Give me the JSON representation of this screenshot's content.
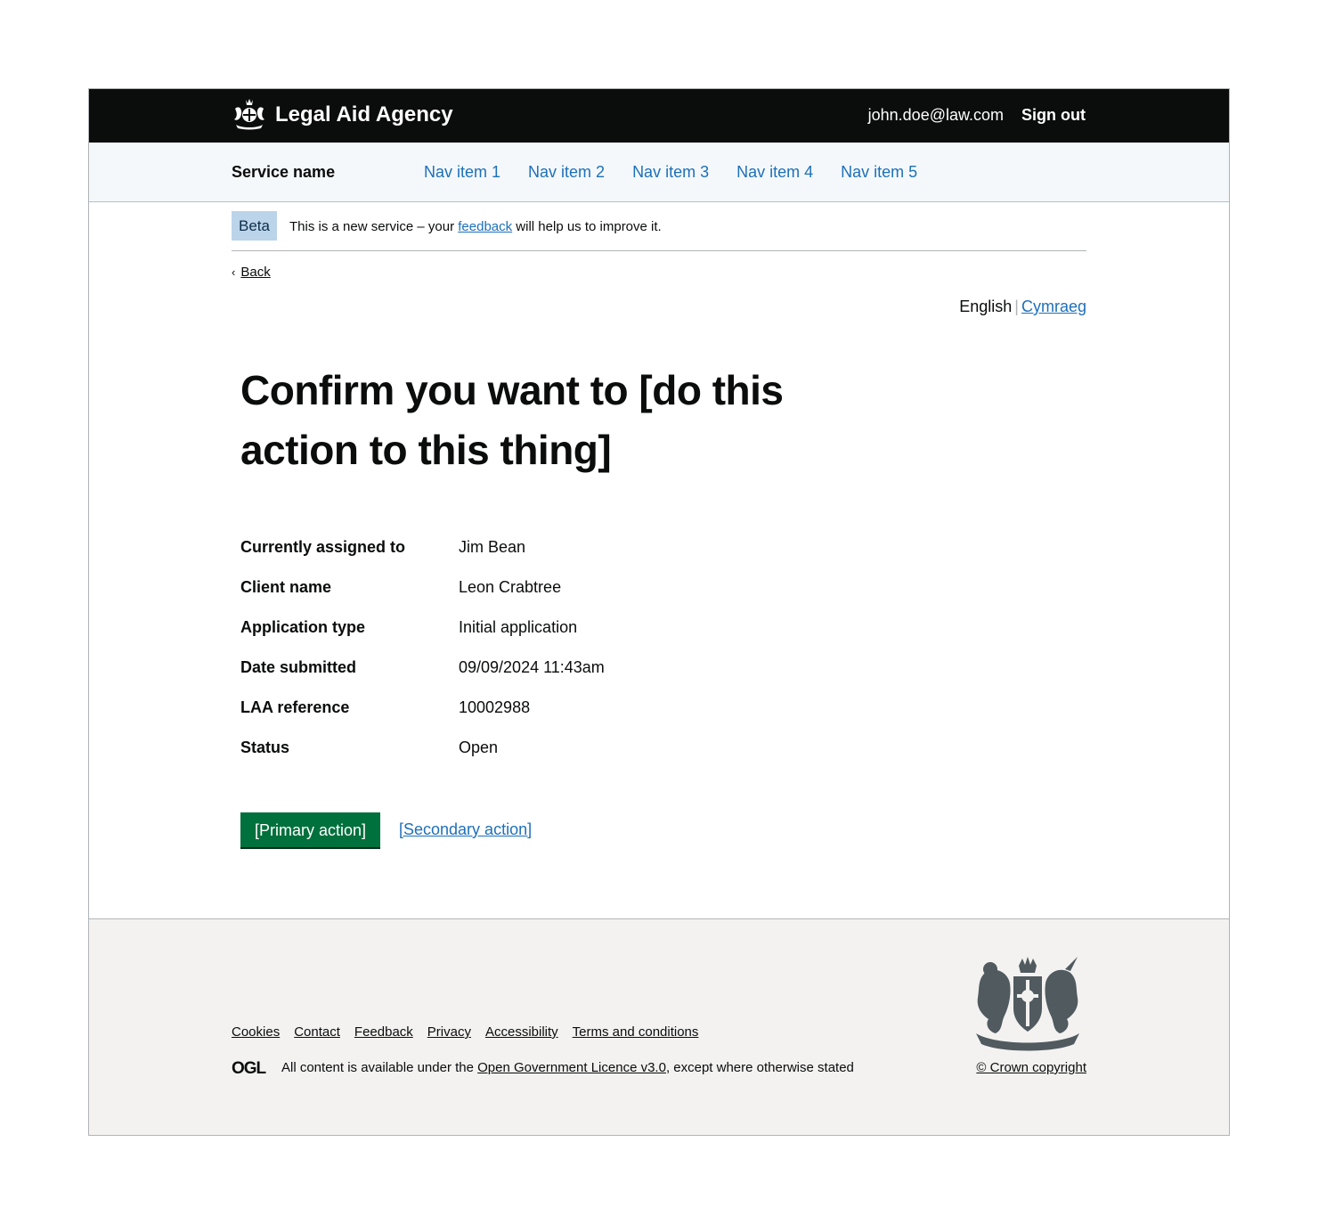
{
  "header": {
    "agency_name": "Legal Aid Agency",
    "user_email": "john.doe@law.com",
    "sign_out_label": "Sign out",
    "background_color": "#0b0c0c"
  },
  "service_nav": {
    "service_name": "Service name",
    "items": [
      {
        "label": "Nav item 1"
      },
      {
        "label": "Nav item 2"
      },
      {
        "label": "Nav item 3"
      },
      {
        "label": "Nav item 4"
      },
      {
        "label": "Nav item 5"
      }
    ]
  },
  "phase_banner": {
    "tag": "Beta",
    "text_before": "This is a new service – your ",
    "link_text": "feedback",
    "text_after": " will help us to improve it."
  },
  "back_link": {
    "chevron": "‹",
    "label": "Back"
  },
  "language": {
    "current": "English",
    "separator": "|",
    "alternate": "Cymraeg"
  },
  "main": {
    "title": "Confirm you want to [do this action to this thing]",
    "summary": [
      {
        "key": "Currently assigned to",
        "value": "Jim Bean"
      },
      {
        "key": "Client name",
        "value": "Leon Crabtree"
      },
      {
        "key": "Application type",
        "value": "Initial application"
      },
      {
        "key": "Date submitted",
        "value": "09/09/2024 11:43am"
      },
      {
        "key": "LAA reference",
        "value": "10002988"
      },
      {
        "key": "Status",
        "value": "Open"
      }
    ],
    "primary_action": "[Primary action]",
    "secondary_action": "[Secondary action]",
    "primary_color": "#00703c",
    "link_color": "#1d70b8"
  },
  "footer": {
    "links": [
      {
        "label": "Cookies"
      },
      {
        "label": "Contact"
      },
      {
        "label": "Feedback"
      },
      {
        "label": "Privacy"
      },
      {
        "label": "Accessibility"
      },
      {
        "label": "Terms and conditions"
      }
    ],
    "ogl_logo_text": "OGL",
    "licence_prefix": "All content is available under the ",
    "licence_link": "Open Government Licence v3.0",
    "licence_suffix": ", except where otherwise stated",
    "copyright": "© Crown copyright",
    "crest_icon": "royal-coat-of-arms-icon",
    "background_color": "#f3f2f1"
  }
}
